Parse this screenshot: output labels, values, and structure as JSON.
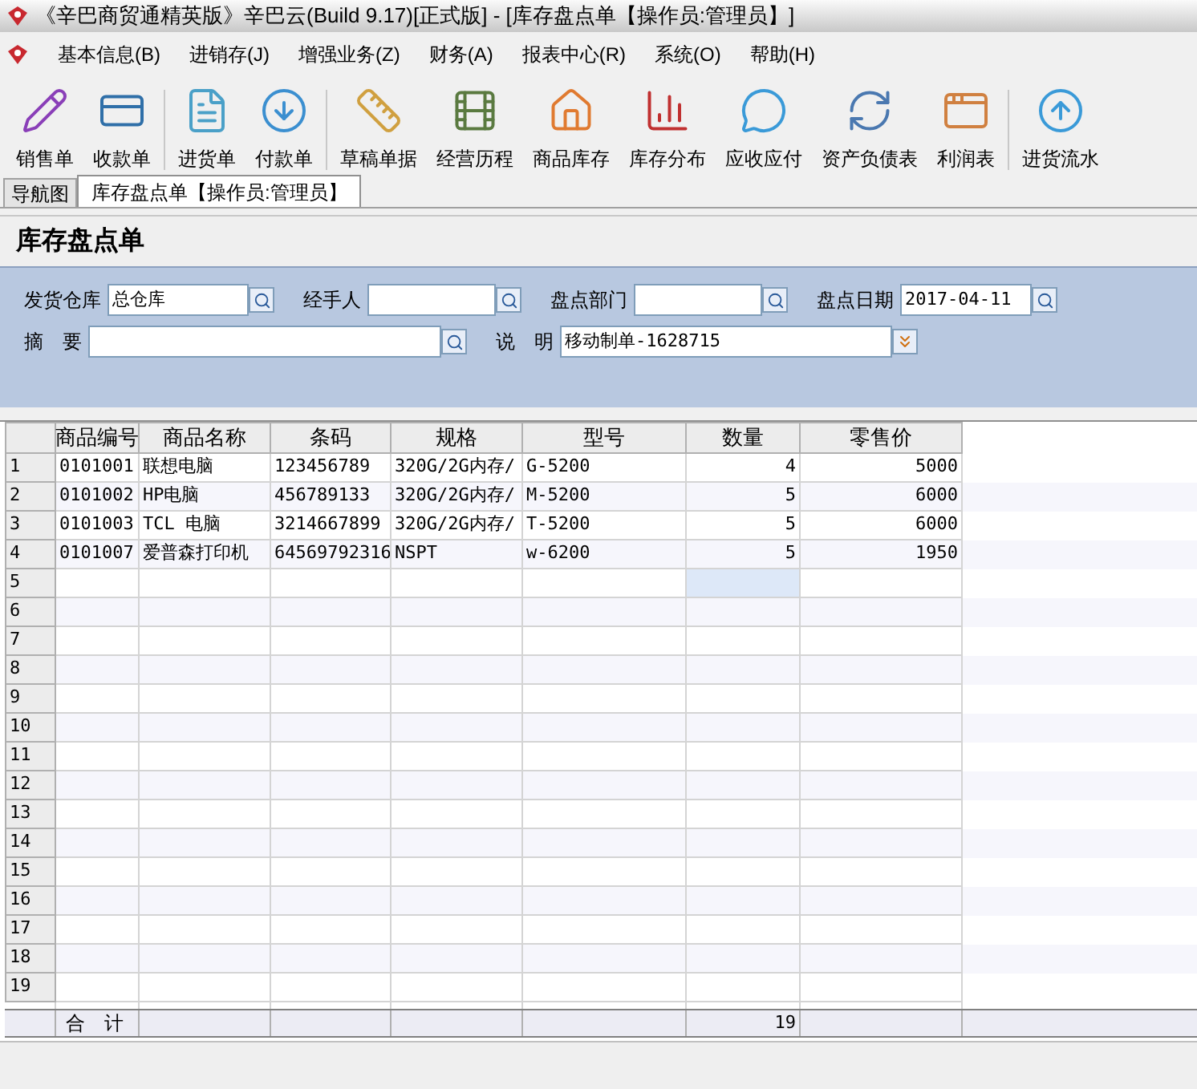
{
  "window": {
    "title": "《辛巴商贸通精英版》辛巴云(Build 9.17)[正式版] - [库存盘点单【操作员:管理员】]"
  },
  "menu": [
    "基本信息(B)",
    "进销存(J)",
    "增强业务(Z)",
    "财务(A)",
    "报表中心(R)",
    "系统(O)",
    "帮助(H)"
  ],
  "toolbar": [
    {
      "label": "销售单",
      "kind": "pencil",
      "separator_before": false
    },
    {
      "label": "收款单",
      "kind": "card",
      "separator_before": false
    },
    {
      "label": "进货单",
      "kind": "doc",
      "separator_before": true
    },
    {
      "label": "付款单",
      "kind": "down",
      "separator_before": false
    },
    {
      "label": "草稿单据",
      "kind": "ruler",
      "separator_before": true
    },
    {
      "label": "经营历程",
      "kind": "film",
      "separator_before": false
    },
    {
      "label": "商品库存",
      "kind": "house",
      "separator_before": false
    },
    {
      "label": "库存分布",
      "kind": "chart",
      "separator_before": false
    },
    {
      "label": "应收应付",
      "kind": "chat",
      "separator_before": false
    },
    {
      "label": "资产负债表",
      "kind": "refresh",
      "separator_before": false
    },
    {
      "label": "利润表",
      "kind": "window",
      "separator_before": false
    },
    {
      "label": "进货流水",
      "kind": "up",
      "separator_before": true
    }
  ],
  "tabs": [
    {
      "label": "导航图",
      "selected": false
    },
    {
      "label": "库存盘点单【操作员:管理员】",
      "selected": true
    }
  ],
  "form": {
    "title": "库存盘点单",
    "field_rows": [
      [
        {
          "label": "发货仓库",
          "value": "总仓库",
          "kind": "lookup"
        },
        {
          "label": "经手人",
          "kind": "lookup"
        },
        {
          "label": "盘点部门",
          "kind": "lookup"
        },
        {
          "label": "盘点日期",
          "value": "2017-04-11",
          "kind": "lookup"
        }
      ],
      [
        {
          "label": "摘　要",
          "kind": "lookup"
        },
        {
          "label": "说　明",
          "value": "移动制单-1628715",
          "kind": "expand"
        }
      ]
    ]
  },
  "table": {
    "columns": [
      "商品编号",
      "商品名称",
      "条码",
      "规格",
      "型号",
      "数量",
      "零售价"
    ],
    "rows": [
      {
        "number": "1",
        "cells": [
          "0101001",
          "联想电脑",
          "123456789",
          "320G/2G内存/",
          "G-5200",
          "4",
          "5000"
        ],
        "selected": false
      },
      {
        "number": "2",
        "cells": [
          "0101002",
          "HP电脑",
          "456789133",
          "320G/2G内存/",
          "M-5200",
          "5",
          "6000"
        ],
        "selected": false
      },
      {
        "number": "3",
        "cells": [
          "0101003",
          "TCL 电脑",
          "3214667899",
          "320G/2G内存/",
          "T-5200",
          "5",
          "6000"
        ],
        "selected": false
      },
      {
        "number": "4",
        "cells": [
          "0101007",
          "爱普森打印机",
          "64569792316",
          "NSPT",
          "w-6200",
          "5",
          "1950"
        ],
        "selected": false
      },
      {
        "number": "5",
        "cells": [],
        "selected": true
      },
      {
        "number": "6",
        "cells": [],
        "selected": false
      },
      {
        "number": "7",
        "cells": [],
        "selected": false
      },
      {
        "number": "8",
        "cells": [],
        "selected": false
      },
      {
        "number": "9",
        "cells": [],
        "selected": false
      },
      {
        "number": "10",
        "cells": [],
        "selected": false
      },
      {
        "number": "11",
        "cells": [],
        "selected": false
      },
      {
        "number": "12",
        "cells": [],
        "selected": false
      },
      {
        "number": "13",
        "cells": [],
        "selected": false
      },
      {
        "number": "14",
        "cells": [],
        "selected": false
      },
      {
        "number": "15",
        "cells": [],
        "selected": false
      },
      {
        "number": "16",
        "cells": [],
        "selected": false
      },
      {
        "number": "17",
        "cells": [],
        "selected": false
      },
      {
        "number": "18",
        "cells": [],
        "selected": false
      },
      {
        "number": "19",
        "cells": [],
        "selected": false
      }
    ],
    "total": {
      "label": "合　计",
      "quantity": "19"
    }
  }
}
